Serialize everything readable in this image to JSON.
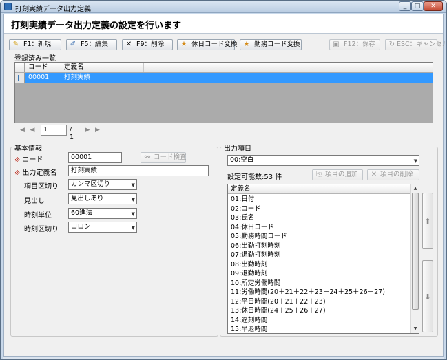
{
  "window": {
    "title": "打刻実績データ出力定義"
  },
  "header": {
    "title": "打刻実績データ出力定義の設定を行います"
  },
  "toolbar": {
    "new_label": "F1：新規",
    "edit_label": "F5：編集",
    "delete_label": "F9：削除",
    "holiday_code_label": "休日コード変換",
    "work_code_label": "勤務コード変換",
    "save_label": "F12：保存",
    "cancel_label": "ESC：キャンセル"
  },
  "registered": {
    "section_label": "登録済み一覧",
    "columns": [
      "コード",
      "定義名"
    ],
    "rows": [
      {
        "code": "00001",
        "name": "打刻実績"
      }
    ]
  },
  "pager": {
    "page": "1",
    "total": "/ 1"
  },
  "basic": {
    "section_label": "基本情報",
    "code_label": "コード",
    "code_value": "00001",
    "code_check_label": "コード検査",
    "def_name_label": "出力定義名",
    "def_name_value": "打刻実績",
    "item_sep_label": "項目区切り",
    "item_sep_value": "カンマ区切り",
    "heading_label": "見出し",
    "heading_value": "見出しあり",
    "time_unit_label": "時刻単位",
    "time_unit_value": "60進法",
    "time_sep_label": "時刻区切り",
    "time_sep_value": "コロン"
  },
  "output": {
    "section_label": "出力項目",
    "selected_item": "00:空白",
    "count_text": "設定可能数:53 件",
    "add_label": "項目の追加",
    "remove_label": "項目の削除",
    "list_header": "定義名",
    "items": [
      "01:日付",
      "02:コード",
      "03:氏名",
      "04:休日コード",
      "05:勤務時間コード",
      "06:出勤打刻時刻",
      "07:退勤打刻時刻",
      "08:出勤時刻",
      "09:退勤時刻",
      "10:所定労働時間",
      "11:労働時間(20＋21＋22＋23＋24＋25＋26＋27)",
      "12:平日時間(20＋21＋22＋23)",
      "13:休日時間(24＋25＋26＋27)",
      "14:遅刻時間",
      "15:早退時間"
    ]
  },
  "icons": {
    "up": "arrow-up-icon",
    "down": "arrow-down-icon"
  }
}
